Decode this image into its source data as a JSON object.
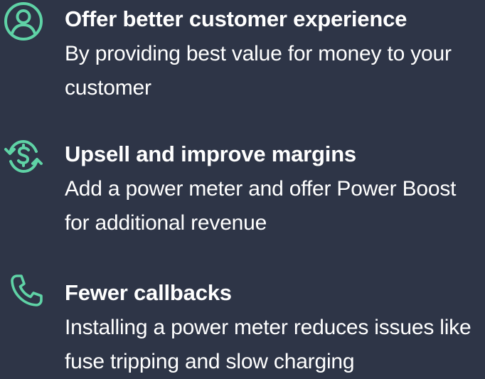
{
  "colors": {
    "background": "#2e3547",
    "accent": "#5fd3a6",
    "text": "#ffffff"
  },
  "features": [
    {
      "icon": "user-circle-icon",
      "title": "Offer better customer experience",
      "description": "By providing best value for money to your customer"
    },
    {
      "icon": "dollar-cycle-icon",
      "title": "Upsell and improve margins",
      "description": "Add a power meter and offer Power Boost for additional revenue"
    },
    {
      "icon": "phone-icon",
      "title": "Fewer callbacks",
      "description": "Installing a power meter reduces issues like fuse tripping and slow charging"
    }
  ]
}
